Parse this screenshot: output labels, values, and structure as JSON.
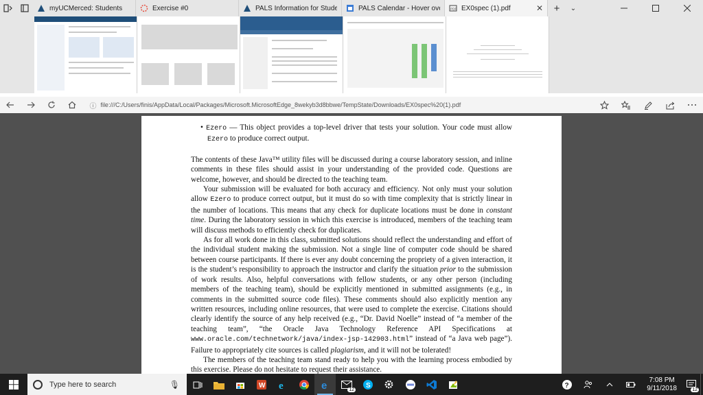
{
  "window": {
    "tabs": [
      {
        "title": "myUCMerced: Students",
        "favicon_color": "#1f4e79"
      },
      {
        "title": "Exercise #0",
        "favicon_color": "#e74c3c"
      },
      {
        "title": "PALS Information for Studer",
        "favicon_color": "#1f4e79"
      },
      {
        "title": "PALS Calendar - Hover over",
        "favicon_color": "#3a7bd5"
      },
      {
        "title": "EX0spec (1).pdf",
        "favicon_color": "#444444"
      }
    ],
    "active_tab": 4,
    "close_glyph": "✕",
    "new_tab_glyph": "+",
    "tab_list_glyph": "⌄"
  },
  "address": {
    "url": "file:///C:/Users/finis/AppData/Local/Packages/Microsoft.MicrosoftEdge_8wekyb3d8bbwe/TempState/Downloads/EX0spec%20(1).pdf"
  },
  "nav_icons": [
    "back-arrow-icon",
    "forward-arrow-icon",
    "refresh-icon",
    "home-icon"
  ],
  "toolbar_icons": [
    "favorites-star-icon",
    "favorites-hub-icon",
    "pen-icon",
    "share-icon",
    "more-icon"
  ],
  "document": {
    "bullet": {
      "code": "Ezero",
      "text": " — This object provides a top-level driver that tests your solution. Your code must allow ",
      "code2": "Ezero",
      "text2": " to produce correct output."
    },
    "p1": "The contents of these Java™ utility files will be discussed during a course laboratory session, and inline comments in these files should assist in your understanding of the provided code. Questions are welcome, however, and should be directed to the teaching team.",
    "p2a": "Your submission will be evaluated for both accuracy and efficiency. Not only must your solution allow ",
    "p2code": "Ezero",
    "p2b": " to produce correct output, but it must do so with time complexity that is strictly linear in the number of locations. This means that any check for duplicate locations must be done in ",
    "p2em": "constant time",
    "p2c": ". During the laboratory session in which this exercise is introduced, members of the teaching team will discuss methods to efficiently check for duplicates.",
    "p3a": "As for all work done in this class, submitted solutions should reflect the understanding and effort of the individual student making the submission. Not a single line of computer code should be shared between course participants. If there is ever any doubt concerning the propriety of a given interaction, it is the student’s responsibility to approach the instructor and clarify the situation ",
    "p3em": "prior",
    "p3b": " to the submission of work results. Also, helpful conversations with fellow students, or any other person (including members of the teaching team), should be explicitly mentioned in submitted assignments (e.g., in comments in the submitted source code files). These comments should also explicitly mention any written resources, including online resources, that were used to complete the exercise. Citations should clearly identify the source of any help received (e.g., “Dr. David Noelle” instead of “a member of the teaching team”, “the Oracle Java Technology Reference API Specifications at ",
    "p3url": "www.oracle.com/technetwork/java/index-jsp-142903.html",
    "p3c": "” instead of “a Java web page”). Failure to appropriately cite sources is called ",
    "p3em2": "plagiarism",
    "p3d": ", and it will not be tolerated!",
    "p4": "The members of the teaching team stand ready to help you with the learning process embodied by this exercise. Please do not hesitate to request their assistance."
  },
  "taskbar": {
    "search_placeholder": "Type here to search",
    "time": "7:08 PM",
    "date": "9/11/2018",
    "mail_badge": "12",
    "notif_badge": "12",
    "apps": [
      "task-view-icon",
      "file-explorer-icon",
      "store-icon",
      "office-icon",
      "ie-icon",
      "chrome-icon",
      "edge-icon",
      "mail-icon",
      "skype-icon",
      "settings-icon",
      "discord-icon",
      "vscode-icon",
      "paint-icon"
    ]
  }
}
